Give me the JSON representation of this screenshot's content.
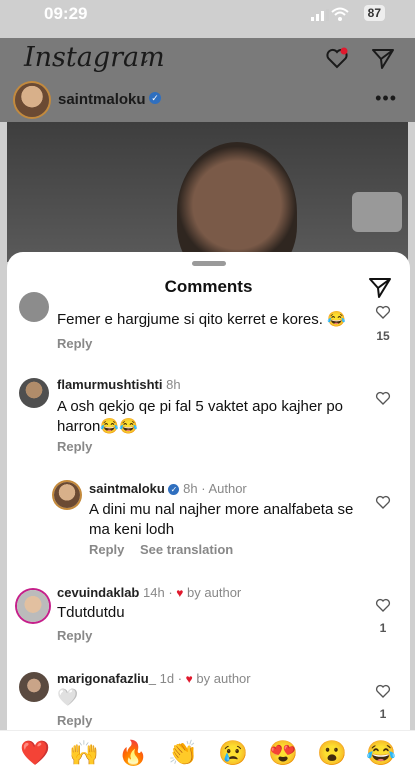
{
  "status_bar": {
    "time": "09:29",
    "battery": "87"
  },
  "header": {
    "logo": "Instagram"
  },
  "post": {
    "username": "saintmaloku"
  },
  "comments_sheet": {
    "title": "Comments",
    "comments": [
      {
        "text": "Femer e hargjume si qito kerret e kores. 😂",
        "reply": "Reply",
        "likes": "15"
      },
      {
        "username": "flamurmushtishti",
        "time": "8h",
        "text": "A osh qekjo qe pi fal 5 vaktet apo kajher po harron😂😂",
        "reply": "Reply"
      },
      {
        "username": "saintmaloku",
        "time": "8h",
        "author_tag": "Author",
        "text": "A dini mu nal najher more analfabeta se ma keni lodh",
        "reply": "Reply",
        "translation": "See translation"
      },
      {
        "username": "cevuindaklab",
        "time": "14h",
        "by_author": "by author",
        "text": "Tdutdutdu",
        "reply": "Reply",
        "likes": "1"
      },
      {
        "username": "marigonafazliu_",
        "time": "1d",
        "by_author": "by author",
        "text": "🤍",
        "reply": "Reply",
        "likes": "1"
      }
    ]
  },
  "emoji_bar": [
    "❤️",
    "🙌",
    "🔥",
    "👏",
    "😢",
    "😍",
    "😮",
    "😂"
  ]
}
